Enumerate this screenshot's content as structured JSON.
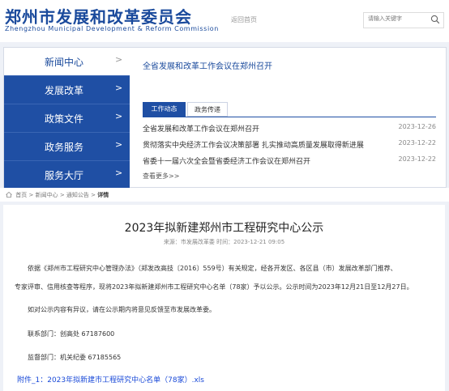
{
  "header": {
    "org_name_cn": "郑州市发展和改革委员会",
    "org_name_en": "Zhengzhou Municipal Development & Reform Commission",
    "home_link": "返回首页",
    "search_placeholder": "请输入关键字",
    "brand_color": "#1a4a9c"
  },
  "sidebar": {
    "items": [
      {
        "label": "新闻中心",
        "icon": "chevron-right-icon"
      },
      {
        "label": "发展改革",
        "icon": "chevron-right-icon"
      },
      {
        "label": "政策文件",
        "icon": "chevron-right-icon"
      },
      {
        "label": "政务服务",
        "icon": "chevron-right-icon"
      },
      {
        "label": "服务大厅",
        "icon": "chevron-right-icon"
      }
    ],
    "chevron": ">"
  },
  "news_panel": {
    "headline": "全省发展和改革工作会议在郑州召开",
    "tabs": [
      {
        "label": "工作动态",
        "active": true
      },
      {
        "label": "政务传递",
        "active": false
      }
    ],
    "items": [
      {
        "title": "全省发展和改革工作会议在郑州召开",
        "date": "2023-12-26"
      },
      {
        "title": "贯彻落实中央经济工作会议决策部署 扎实推动高质量发展取得新进展",
        "date": "2023-12-22"
      },
      {
        "title": "省委十一届六次全会暨省委经济工作会议在郑州召开",
        "date": "2023-12-22"
      }
    ],
    "more": "查看更多>>"
  },
  "breadcrumb": {
    "items": [
      "首页",
      "新闻中心",
      "通知公告"
    ],
    "separator": ">",
    "current": "详情"
  },
  "article": {
    "title": "2023年拟新建郑州市工程研究中心公示",
    "meta": "来源：市发展改革委  时间：2023-12-21 09:05",
    "para1_line1": "依据《郑州市工程研究中心管理办法》（郑发改高技〔2016〕559号）有关规定，经各开发区、各区县（市）发展改革部门推荐、",
    "para1_line2": "专家评审、信用核查等程序，现将2023年拟新建郑州市工程研究中心名单（78家）予以公示。公示时间为2023年12月21日至12月27日。",
    "para2": "如对公示内容有异议，请在公示期内将意见反馈至市发展改革委。",
    "contact_dept": "联系部门：创高处   67187600",
    "supervise_dept": "监督部门：机关纪委 67185565",
    "attachment": "附件_1：2023年拟新建市工程研究中心名单（78家）.xls"
  }
}
